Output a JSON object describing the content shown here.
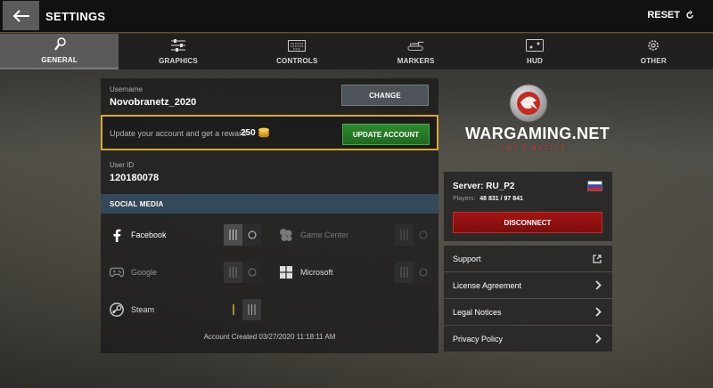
{
  "header": {
    "title": "SETTINGS",
    "reset_label": "RESET"
  },
  "tabs": [
    {
      "label": "GENERAL",
      "icon": "wrench-icon",
      "active": true
    },
    {
      "label": "GRAPHICS",
      "icon": "sliders-icon",
      "active": false
    },
    {
      "label": "CONTROLS",
      "icon": "keyboard-icon",
      "active": false
    },
    {
      "label": "MARKERS",
      "icon": "tank-icon",
      "active": false
    },
    {
      "label": "HUD",
      "icon": "hud-icon",
      "active": false
    },
    {
      "label": "OTHER",
      "icon": "gear-icon",
      "active": false
    }
  ],
  "account": {
    "username_label": "Username",
    "username": "Novobranetz_2020",
    "change_label": "CHANGE",
    "reward_text": "Update your account and get a reward",
    "reward_amount": "250",
    "update_label": "UPDATE ACCOUNT",
    "userid_label": "User ID",
    "userid": "120180078",
    "created": "Account Created 03/27/2020 11:18:11 AM"
  },
  "social": {
    "header": "SOCIAL MEDIA",
    "items": [
      {
        "label": "Facebook",
        "icon": "facebook-icon",
        "enabled": true
      },
      {
        "label": "Game Center",
        "icon": "game-center-icon",
        "enabled": false
      },
      {
        "label": "Google",
        "icon": "gamepad-icon",
        "enabled": true
      },
      {
        "label": "Microsoft",
        "icon": "windows-icon",
        "enabled": false
      },
      {
        "label": "Steam",
        "icon": "steam-icon",
        "enabled": true
      }
    ]
  },
  "brand": {
    "name": "WARGAMING.NET",
    "tagline": "LET'S BATTLE"
  },
  "server": {
    "name": "Server: RU_P2",
    "players_label": "Players:",
    "players_value": "48 831 / 97 841",
    "disconnect_label": "DISCONNECT"
  },
  "links": [
    {
      "label": "Support",
      "icon": "external-link-icon"
    },
    {
      "label": "License Agreement",
      "icon": "chevron-right-icon"
    },
    {
      "label": "Legal Notices",
      "icon": "chevron-right-icon"
    },
    {
      "label": "Privacy Policy",
      "icon": "chevron-right-icon"
    }
  ],
  "colors": {
    "accent_gold": "#d7a833",
    "update_green": "#2e8a2e",
    "disconnect_red": "#a31414",
    "social_header": "#34495a"
  }
}
